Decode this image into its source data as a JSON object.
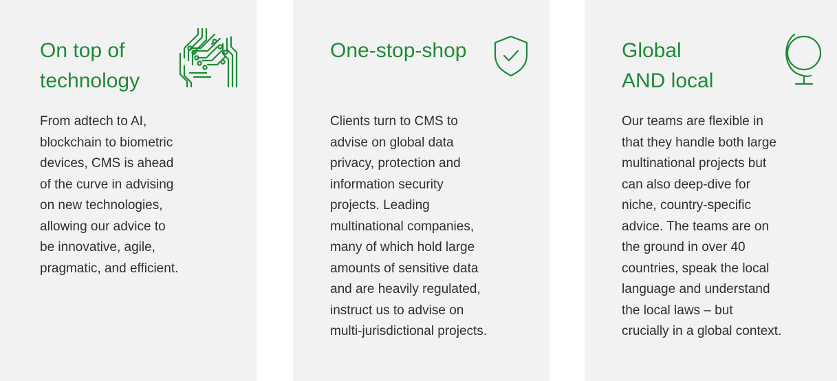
{
  "cards": [
    {
      "title_lines": [
        "On top of",
        "technology"
      ],
      "icon": "circuit-board-icon",
      "body_lines": [
        "From adtech to AI,",
        "blockchain to biometric",
        "devices, CMS is ahead",
        "of the curve in advising",
        "on new technologies,",
        "allowing our advice to",
        "be innovative, agile,",
        "pragmatic, and efficient."
      ]
    },
    {
      "title_lines": [
        "One-stop-shop"
      ],
      "icon": "shield-check-icon",
      "body_lines": [
        "Clients turn to CMS to",
        "advise on global data",
        "privacy, protection and",
        "information security",
        "projects. Leading",
        "multinational companies,",
        "many of which hold large",
        "amounts of sensitive data",
        "and are heavily regulated,",
        "instruct us to advise on",
        "multi-jurisdictional projects."
      ]
    },
    {
      "title_lines": [
        "Global",
        "AND local"
      ],
      "icon": "globe-icon",
      "body_lines": [
        "Our teams are flexible in",
        "that they handle both large",
        "multinational projects but",
        "can also deep-dive for",
        "niche, country-specific",
        "advice. The teams are on",
        "the ground in over 40",
        "countries, speak the local",
        "language and understand",
        "the local laws – but",
        "crucially in a global context."
      ]
    }
  ],
  "colors": {
    "accent": "#1e8a36",
    "card_bg": "#f2f2f3",
    "text": "#2f2f2f"
  }
}
